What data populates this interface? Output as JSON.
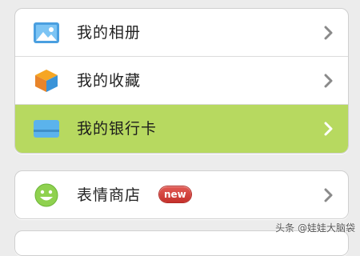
{
  "menu": {
    "group1": [
      {
        "label": "我的相册",
        "icon": "photo-album-icon"
      },
      {
        "label": "我的收藏",
        "icon": "favorites-cube-icon"
      },
      {
        "label": "我的银行卡",
        "icon": "bank-card-icon",
        "selected": true
      }
    ],
    "group2": [
      {
        "label": "表情商店",
        "icon": "smiley-face-icon",
        "badge": "new"
      }
    ]
  },
  "watermark": "头条 @娃娃大脑袋",
  "colors": {
    "selected_row": "#b7d960",
    "badge": "#d23b35",
    "chevron": "#8a8a8a",
    "page_background": "#ececec"
  }
}
